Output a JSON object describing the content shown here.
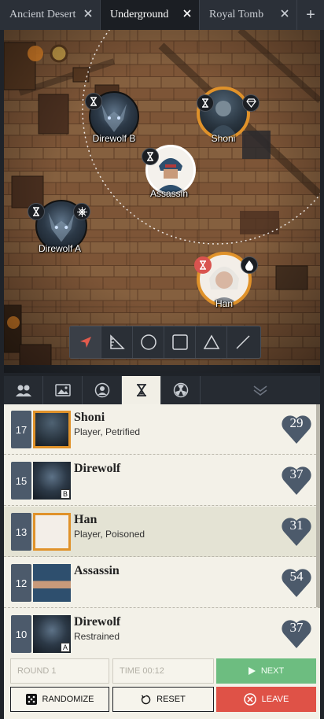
{
  "tabs": [
    {
      "label": "Ancient Desert",
      "active": false
    },
    {
      "label": "Underground",
      "active": true
    },
    {
      "label": "Royal Tomb",
      "active": false
    }
  ],
  "tab_add_label": "+",
  "map_tokens": {
    "direwolf_b": {
      "name": "Direwolf B",
      "status_icon": "hourglass-icon"
    },
    "shoni": {
      "name": "Shoni",
      "status_icon": "hourglass-icon",
      "condition_icon": "diamond-icon"
    },
    "assassin": {
      "name": "Assassin",
      "status_icon": "hourglass-icon"
    },
    "direwolf_a": {
      "name": "Direwolf A",
      "status_icon": "hourglass-icon",
      "condition_icon": "web-icon"
    },
    "han": {
      "name": "Han",
      "status_icon": "hourglass-icon",
      "condition_icon": "drop-icon"
    }
  },
  "map_tools": [
    "pointer-icon",
    "ruler-icon",
    "circle-icon",
    "square-icon",
    "triangle-icon",
    "line-icon"
  ],
  "panel_tabs": [
    "party-icon",
    "image-icon",
    "user-icon",
    "hourglass-icon",
    "radiation-icon"
  ],
  "initiative": [
    {
      "init": "17",
      "name": "Shoni",
      "sub": "Player, Petrified",
      "hp": "29",
      "letter": ""
    },
    {
      "init": "15",
      "name": "Direwolf",
      "sub": "",
      "hp": "37",
      "letter": "B"
    },
    {
      "init": "13",
      "name": "Han",
      "sub": "Player, Poisoned",
      "hp": "31",
      "letter": ""
    },
    {
      "init": "12",
      "name": "Assassin",
      "sub": "",
      "hp": "54",
      "letter": ""
    },
    {
      "init": "10",
      "name": "Direwolf",
      "sub": "Restrained",
      "hp": "37",
      "letter": "A"
    }
  ],
  "controls": {
    "round": "ROUND 1",
    "time": "TIME  00:12",
    "next": "NEXT",
    "randomize": "RANDOMIZE",
    "reset": "RESET",
    "leave": "LEAVE"
  },
  "colors": {
    "accent_gold": "#e0922a",
    "next_green": "#6dbd80",
    "leave_red": "#df5247",
    "hp_heart": "#4c5a6b"
  }
}
